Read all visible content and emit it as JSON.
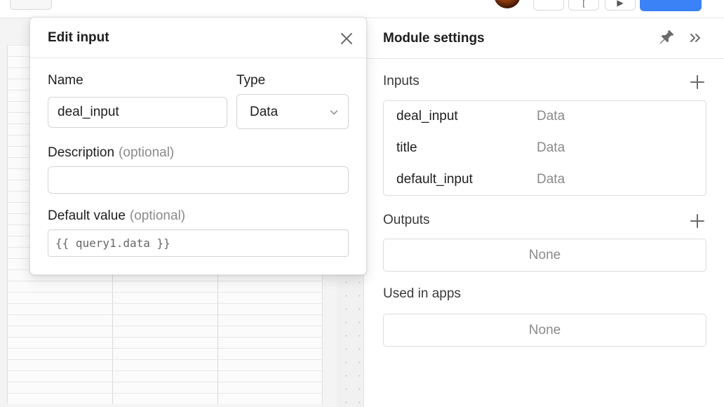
{
  "modal": {
    "title": "Edit input",
    "name_label": "Name",
    "name_value": "deal_input",
    "type_label": "Type",
    "type_value": "Data",
    "description_label": "Description",
    "description_optional": "(optional)",
    "description_value": "",
    "default_label": "Default value",
    "default_optional": "(optional)",
    "default_placeholder": "{{ query1.data }}"
  },
  "panel": {
    "title": "Module settings",
    "inputs_label": "Inputs",
    "inputs": [
      {
        "name": "deal_input",
        "type": "Data"
      },
      {
        "name": "title",
        "type": "Data"
      },
      {
        "name": "default_input",
        "type": "Data"
      }
    ],
    "outputs_label": "Outputs",
    "outputs_empty": "None",
    "used_in_apps_label": "Used in apps",
    "used_in_apps_empty": "None"
  },
  "colors": {
    "primary": "#3b82f6",
    "muted_text": "#8a8a8a",
    "border": "#dcdcdc"
  },
  "icons": [
    "close-icon",
    "pin-icon",
    "collapse-icon",
    "plus-icon",
    "chevron-down-icon"
  ]
}
